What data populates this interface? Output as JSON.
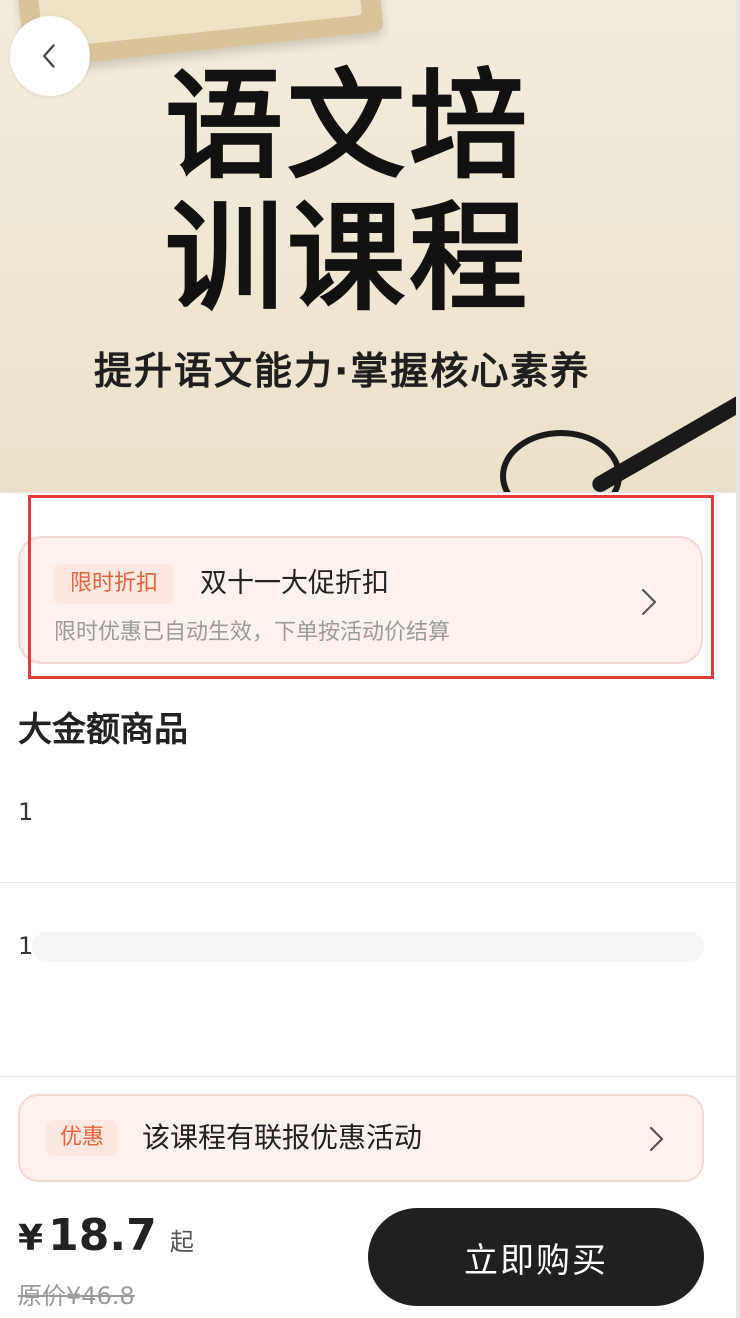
{
  "banner": {
    "title": "语文培训课程",
    "subtitle": "提升语文能力·掌握核心素养"
  },
  "promo": {
    "tag": "限时折扣",
    "title": "双十一大促折扣",
    "desc": "限时优惠已自动生效，下单按活动价结算"
  },
  "product": {
    "title": "大金额商品",
    "line1": "1",
    "line2": "1"
  },
  "bundle": {
    "tag": "优惠",
    "text": "该课程有联报优惠活动"
  },
  "purchase": {
    "currency": "¥",
    "price": "18.7",
    "price_suffix": "起",
    "original_price": "原价¥46.8",
    "buy_label": "立即购买"
  },
  "icons": {
    "back": "chevron-left-icon",
    "promo_arrow": "chevron-right-icon",
    "bundle_arrow": "chevron-right-icon"
  },
  "colors": {
    "accent": "#e2643d",
    "highlight": "#e53935",
    "buy_button_bg": "#202020"
  }
}
